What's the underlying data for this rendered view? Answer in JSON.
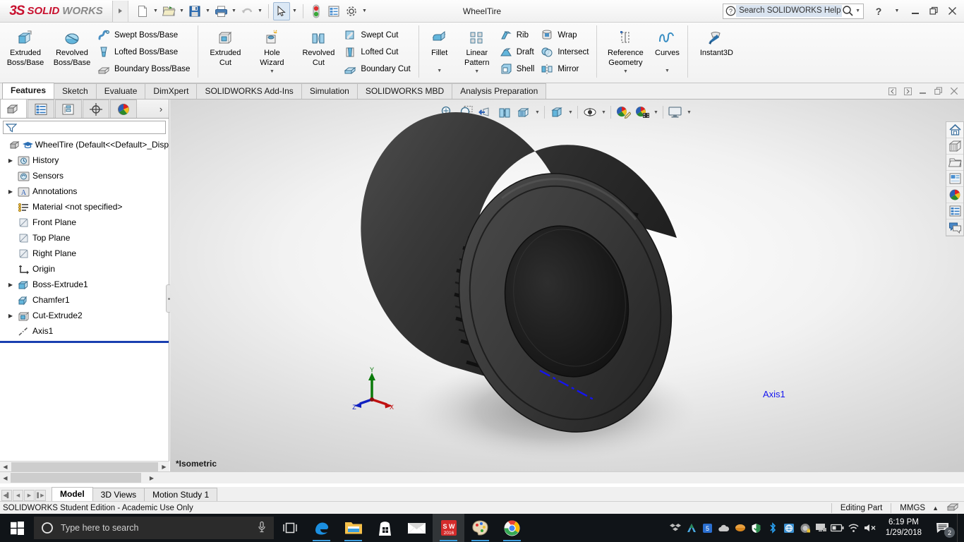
{
  "titlebar": {
    "logo_ds": "3S",
    "logo_solid": "SOLID",
    "logo_works": "WORKS",
    "document_title": "WheelTire",
    "help_placeholder": "Search SOLIDWORKS Help",
    "quick_access": [
      {
        "name": "new-document",
        "label": "New"
      },
      {
        "name": "open-document",
        "label": "Open"
      },
      {
        "name": "save-document",
        "label": "Save"
      },
      {
        "name": "print-document",
        "label": "Print"
      },
      {
        "name": "undo",
        "label": "Undo"
      },
      {
        "name": "select",
        "label": "Select"
      },
      {
        "name": "rebuild",
        "label": "Rebuild"
      },
      {
        "name": "file-properties",
        "label": "File Properties"
      },
      {
        "name": "options",
        "label": "Options"
      }
    ],
    "window_controls": {
      "help": "?",
      "minimize": "—",
      "restore": "❐",
      "close": "✕"
    }
  },
  "ribbon": {
    "groups": [
      {
        "name": "features-primary",
        "big_buttons": [
          {
            "name": "extruded-boss-base",
            "line1": "Extruded",
            "line2": "Boss/Base",
            "icon": "extrude-boss-icon"
          },
          {
            "name": "revolved-boss-base",
            "line1": "Revolved",
            "line2": "Boss/Base",
            "icon": "revolve-boss-icon"
          }
        ],
        "small_buttons": [
          {
            "name": "swept-boss-base",
            "label": "Swept Boss/Base",
            "icon": "swept-boss-icon"
          },
          {
            "name": "lofted-boss-base",
            "label": "Lofted Boss/Base",
            "icon": "lofted-boss-icon"
          },
          {
            "name": "boundary-boss-base",
            "label": "Boundary Boss/Base",
            "icon": "boundary-boss-icon"
          }
        ]
      },
      {
        "name": "cut-features",
        "big_buttons": [
          {
            "name": "extruded-cut",
            "line1": "Extruded",
            "line2": "Cut",
            "icon": "extrude-cut-icon"
          },
          {
            "name": "hole-wizard",
            "line1": "Hole",
            "line2": "Wizard",
            "icon": "hole-wizard-icon",
            "dropdown": true
          },
          {
            "name": "revolved-cut",
            "line1": "Revolved",
            "line2": "Cut",
            "icon": "revolve-cut-icon"
          }
        ],
        "small_buttons": [
          {
            "name": "swept-cut",
            "label": "Swept Cut",
            "icon": "swept-cut-icon"
          },
          {
            "name": "lofted-cut",
            "label": "Lofted Cut",
            "icon": "lofted-cut-icon"
          },
          {
            "name": "boundary-cut",
            "label": "Boundary Cut",
            "icon": "boundary-cut-icon"
          }
        ]
      },
      {
        "name": "modify-features",
        "big_buttons": [
          {
            "name": "fillet",
            "line1": "Fillet",
            "line2": "",
            "icon": "fillet-icon",
            "dropdown": true
          },
          {
            "name": "linear-pattern",
            "line1": "Linear",
            "line2": "Pattern",
            "icon": "linear-pattern-icon",
            "dropdown": true
          }
        ],
        "small_buttons": [
          {
            "name": "rib",
            "label": "Rib",
            "icon": "rib-icon"
          },
          {
            "name": "draft",
            "label": "Draft",
            "icon": "draft-icon"
          },
          {
            "name": "shell",
            "label": "Shell",
            "icon": "shell-icon"
          }
        ],
        "small_buttons2": [
          {
            "name": "wrap",
            "label": "Wrap",
            "icon": "wrap-icon"
          },
          {
            "name": "intersect",
            "label": "Intersect",
            "icon": "intersect-icon"
          },
          {
            "name": "mirror",
            "label": "Mirror",
            "icon": "mirror-icon"
          }
        ]
      },
      {
        "name": "reference-group",
        "big_buttons": [
          {
            "name": "reference-geometry",
            "line1": "Reference",
            "line2": "Geometry",
            "icon": "reference-geometry-icon",
            "dropdown": true
          },
          {
            "name": "curves",
            "line1": "Curves",
            "line2": "",
            "icon": "curves-icon",
            "dropdown": true
          }
        ]
      },
      {
        "name": "instant3d-group",
        "big_buttons": [
          {
            "name": "instant3d",
            "line1": "Instant3D",
            "line2": "",
            "icon": "instant3d-icon"
          }
        ]
      }
    ]
  },
  "command_tabs": {
    "items": [
      {
        "name": "tab-features",
        "label": "Features",
        "active": true
      },
      {
        "name": "tab-sketch",
        "label": "Sketch",
        "active": false
      },
      {
        "name": "tab-evaluate",
        "label": "Evaluate",
        "active": false
      },
      {
        "name": "tab-dimxpert",
        "label": "DimXpert",
        "active": false
      },
      {
        "name": "tab-solidworks-addins",
        "label": "SOLIDWORKS Add-Ins",
        "active": false
      },
      {
        "name": "tab-simulation",
        "label": "Simulation",
        "active": false
      },
      {
        "name": "tab-solidworks-mbd",
        "label": "SOLIDWORKS MBD",
        "active": false
      },
      {
        "name": "tab-analysis-preparation",
        "label": "Analysis Preparation",
        "active": false
      }
    ],
    "doc_controls": [
      "◁",
      "▷",
      "—",
      "❐",
      "✕"
    ]
  },
  "feature_manager": {
    "tabs": [
      {
        "name": "fm-tab-feature-tree",
        "icon": "feature-tree-icon",
        "active": true
      },
      {
        "name": "fm-tab-property-manager",
        "icon": "property-manager-icon",
        "active": false
      },
      {
        "name": "fm-tab-configuration-manager",
        "icon": "configuration-manager-icon",
        "active": false
      },
      {
        "name": "fm-tab-dimxpert-manager",
        "icon": "dimxpert-manager-icon",
        "active": false
      },
      {
        "name": "fm-tab-display-manager",
        "icon": "display-manager-icon",
        "active": false
      }
    ],
    "filter_placeholder": "",
    "tree": [
      {
        "name": "tree-item-wheeltire",
        "label": "WheelTire  (Default<<Default>_Disp",
        "icon": "part-icon",
        "expandable": false,
        "indent": 0,
        "root": true
      },
      {
        "name": "tree-item-history",
        "label": "History",
        "icon": "history-icon",
        "expandable": true,
        "indent": 1
      },
      {
        "name": "tree-item-sensors",
        "label": "Sensors",
        "icon": "sensors-icon",
        "expandable": false,
        "indent": 1
      },
      {
        "name": "tree-item-annotations",
        "label": "Annotations",
        "icon": "annotations-icon",
        "expandable": true,
        "indent": 1
      },
      {
        "name": "tree-item-material",
        "label": "Material <not specified>",
        "icon": "material-icon",
        "expandable": false,
        "indent": 1
      },
      {
        "name": "tree-item-front-plane",
        "label": "Front Plane",
        "icon": "plane-icon",
        "expandable": false,
        "indent": 1
      },
      {
        "name": "tree-item-top-plane",
        "label": "Top Plane",
        "icon": "plane-icon",
        "expandable": false,
        "indent": 1
      },
      {
        "name": "tree-item-right-plane",
        "label": "Right Plane",
        "icon": "plane-icon",
        "expandable": false,
        "indent": 1
      },
      {
        "name": "tree-item-origin",
        "label": "Origin",
        "icon": "origin-icon",
        "expandable": false,
        "indent": 1
      },
      {
        "name": "tree-item-boss-extrude1",
        "label": "Boss-Extrude1",
        "icon": "boss-extrude-icon",
        "expandable": true,
        "indent": 1
      },
      {
        "name": "tree-item-chamfer1",
        "label": "Chamfer1",
        "icon": "chamfer-icon",
        "expandable": false,
        "indent": 1
      },
      {
        "name": "tree-item-cut-extrude2",
        "label": "Cut-Extrude2",
        "icon": "cut-extrude-icon",
        "expandable": true,
        "indent": 1
      },
      {
        "name": "tree-item-axis1",
        "label": "Axis1",
        "icon": "axis-icon",
        "expandable": false,
        "indent": 1
      }
    ]
  },
  "graphics": {
    "view_orientation_label": "*Isometric",
    "axis_annotation": "Axis1",
    "axis_color": "#1414f0",
    "triad_labels": {
      "x": "X",
      "y": "Y",
      "z": "Z"
    },
    "view_toolbar": [
      {
        "name": "zoom-to-fit-button",
        "icon": "zoom-to-fit-icon"
      },
      {
        "name": "zoom-to-area-button",
        "icon": "zoom-to-area-icon"
      },
      {
        "name": "previous-view-button",
        "icon": "previous-view-icon"
      },
      {
        "name": "section-view-button",
        "icon": "section-view-icon"
      },
      {
        "name": "view-orientation-button",
        "icon": "view-orientation-icon"
      },
      {
        "name": "display-style-button",
        "icon": "display-style-icon",
        "dropdown": true
      },
      {
        "name": "hide-show-items-button",
        "icon": "hide-show-items-icon",
        "dropdown": true
      },
      {
        "name": "edit-appearance-button",
        "icon": "edit-appearance-icon",
        "dropdown": true
      },
      {
        "name": "apply-scene-button",
        "icon": "apply-scene-icon",
        "dropdown": true
      },
      {
        "name": "view-settings-button",
        "icon": "view-settings-icon",
        "dropdown": true
      }
    ]
  },
  "right_bar": [
    {
      "name": "view-home-button",
      "icon": "home-icon"
    },
    {
      "name": "view-palette-button",
      "icon": "view-palette-icon"
    },
    {
      "name": "appearances-folder-button",
      "icon": "folder-icon"
    },
    {
      "name": "custom-properties-button",
      "icon": "custom-properties-icon"
    },
    {
      "name": "display-manager-button",
      "icon": "display-manager-sphere-icon"
    },
    {
      "name": "task-pane-list-button",
      "icon": "list-icon"
    },
    {
      "name": "forum-button",
      "icon": "comments-icon"
    }
  ],
  "bottom": {
    "nav_buttons": [
      "◀❘",
      "◀",
      "▶",
      "❘▶"
    ],
    "tabs": [
      {
        "name": "bottom-tab-model",
        "label": "Model",
        "active": true
      },
      {
        "name": "bottom-tab-3d-views",
        "label": "3D Views",
        "active": false
      },
      {
        "name": "bottom-tab-motion-study",
        "label": "Motion Study 1",
        "active": false
      }
    ]
  },
  "status_bar": {
    "message": "SOLIDWORKS Student Edition - Academic Use Only",
    "editing_state": "Editing Part",
    "units": "MMGS",
    "units_arrow": "▲"
  },
  "taskbar": {
    "search_placeholder": "Type here to search",
    "apps": [
      {
        "name": "taskbar-edge",
        "label": "Microsoft Edge",
        "open": true
      },
      {
        "name": "taskbar-file-explorer",
        "label": "File Explorer",
        "open": true
      },
      {
        "name": "taskbar-store",
        "label": "Microsoft Store",
        "open": false
      },
      {
        "name": "taskbar-mail",
        "label": "Mail",
        "open": false
      },
      {
        "name": "taskbar-solidworks",
        "label": "SOLIDWORKS 2016",
        "open": true,
        "active": true
      },
      {
        "name": "taskbar-paint",
        "label": "Paint",
        "open": true
      },
      {
        "name": "taskbar-chrome",
        "label": "Google Chrome",
        "open": true
      }
    ],
    "tray_icons": [
      {
        "name": "tray-dropbox-icon"
      },
      {
        "name": "tray-autodesk-icon"
      },
      {
        "name": "tray-security-icon"
      },
      {
        "name": "tray-onedrive-icon"
      },
      {
        "name": "tray-update-icon"
      },
      {
        "name": "tray-windows-defender-icon"
      },
      {
        "name": "tray-bluetooth-icon"
      },
      {
        "name": "tray-network-share-icon"
      },
      {
        "name": "tray-safe-icon"
      },
      {
        "name": "tray-display-icon"
      },
      {
        "name": "tray-battery-icon"
      },
      {
        "name": "tray-wifi-icon"
      },
      {
        "name": "tray-volume-muted-icon"
      }
    ],
    "clock_time": "6:19 PM",
    "clock_date": "1/29/2018",
    "notification_count": "2"
  }
}
